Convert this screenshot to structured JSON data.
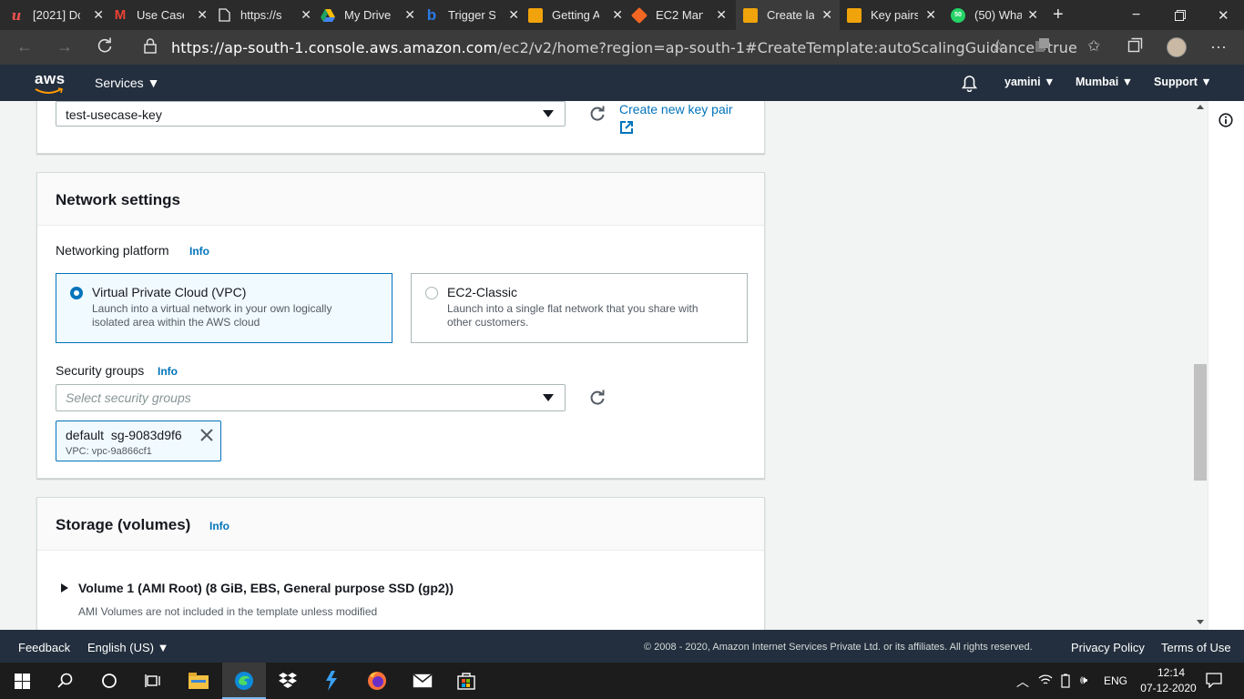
{
  "browser": {
    "tabs": [
      {
        "title": "[2021] Dc",
        "icon": "udemy-icon",
        "color": "#ec5252"
      },
      {
        "title": "Use Case",
        "icon": "gmail-icon",
        "color": "#ea4335"
      },
      {
        "title": "https://s",
        "icon": "page-icon",
        "color": "#ffffff"
      },
      {
        "title": "My Drive",
        "icon": "drive-icon",
        "color": "#34a853"
      },
      {
        "title": "Trigger S",
        "icon": "bing-icon",
        "color": "#2b7be4"
      },
      {
        "title": "Getting A",
        "icon": "aws-box-icon",
        "color": "#f0a30a"
      },
      {
        "title": "EC2 Man",
        "icon": "ec2-icon",
        "color": "#f26722"
      },
      {
        "title": "Create la",
        "icon": "aws-box-icon",
        "color": "#f0a30a",
        "active": true
      },
      {
        "title": "Key pairs",
        "icon": "aws-box-icon",
        "color": "#f0a30a"
      },
      {
        "title": "(50) Wha",
        "icon": "whatsapp-icon",
        "color": "#25d366",
        "badge": "50"
      }
    ],
    "url_host": "https://ap-south-1.console.aws.amazon.com",
    "url_path": "/ec2/v2/home?region=ap-south-1#CreateTemplate:autoScalingGuidance=true"
  },
  "aws_header": {
    "logo": "aws",
    "services": "Services",
    "user": "yamini",
    "region": "Mumbai",
    "support": "Support"
  },
  "key_pair": {
    "selected": "test-usecase-key",
    "create_link": "Create new key pair"
  },
  "network": {
    "title": "Network settings",
    "platform_label": "Networking platform",
    "info": "Info",
    "options": [
      {
        "title": "Virtual Private Cloud (VPC)",
        "desc": "Launch into a virtual network in your own logically isolated area within the AWS cloud",
        "selected": true
      },
      {
        "title": "EC2-Classic",
        "desc": "Launch into a single flat network that you share with other customers.",
        "selected": false
      }
    ],
    "sg_label": "Security groups",
    "sg_placeholder": "Select security groups",
    "token": {
      "name": "default",
      "id": "sg-9083d9f6",
      "vpc": "VPC: vpc-9a866cf1"
    }
  },
  "storage": {
    "title": "Storage (volumes)",
    "info": "Info",
    "volume": "Volume 1 (AMI Root) (8 GiB, EBS, General purpose SSD (gp2))",
    "volume_note": "AMI Volumes are not included in the template unless modified"
  },
  "footer": {
    "feedback": "Feedback",
    "language": "English (US)",
    "copyright": "© 2008 - 2020, Amazon Internet Services Private Ltd. or its affiliates. All rights reserved.",
    "privacy": "Privacy Policy",
    "terms": "Terms of Use"
  },
  "taskbar": {
    "lang": "ENG",
    "time": "12:14",
    "date": "07-12-2020"
  },
  "colors": {
    "aws_navy": "#232f3e",
    "link_blue": "#0073bb",
    "orange": "#ff9900"
  }
}
